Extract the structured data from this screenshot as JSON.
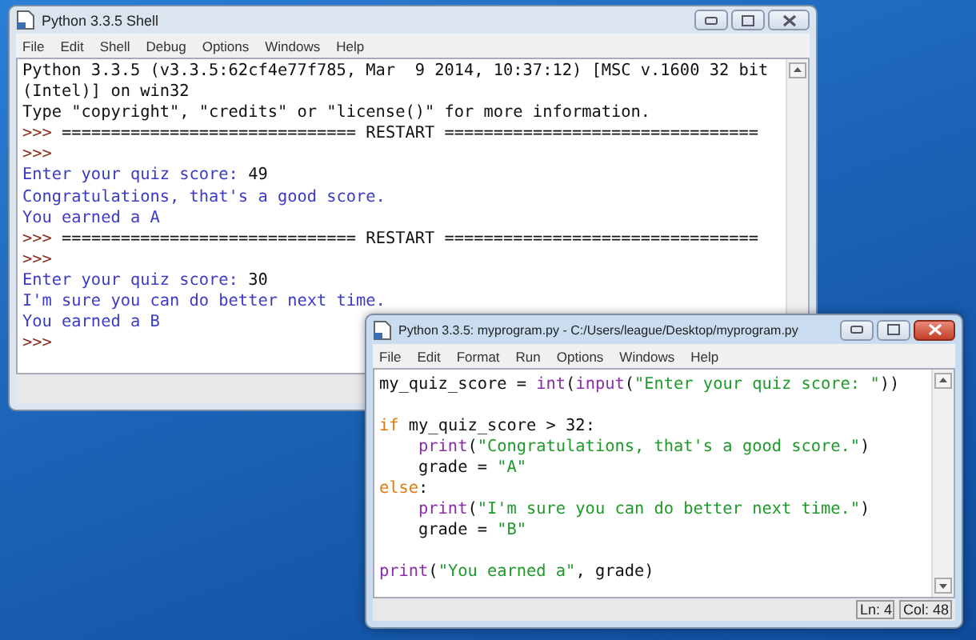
{
  "windows": [
    {
      "kind": "shell",
      "title": "Python 3.3.5 Shell",
      "active": false,
      "menu": [
        "File",
        "Edit",
        "Shell",
        "Debug",
        "Options",
        "Windows",
        "Help"
      ],
      "lines": [
        [
          {
            "text": "Python 3.3.5 (v3.3.5:62cf4e77f785, Mar  9 2014, 10:37:12) [MSC v.1600 32 bit",
            "kind": "plain"
          }
        ],
        [
          {
            "text": "(Intel)] on win32",
            "kind": "plain"
          }
        ],
        [
          {
            "text": "Type \"copyright\", \"credits\" or \"license()\" for more information.",
            "kind": "plain"
          }
        ],
        [
          {
            "text": ">>> ",
            "kind": "prompt"
          },
          {
            "text": "============================== RESTART ================================",
            "kind": "plain"
          }
        ],
        [
          {
            "text": ">>> ",
            "kind": "prompt"
          }
        ],
        [
          {
            "text": "Enter your quiz score: ",
            "kind": "stdout"
          },
          {
            "text": "49",
            "kind": "plain"
          }
        ],
        [
          {
            "text": "Congratulations, that's a good score.",
            "kind": "stdout"
          }
        ],
        [
          {
            "text": "You earned a A",
            "kind": "stdout"
          }
        ],
        [
          {
            "text": ">>> ",
            "kind": "prompt"
          },
          {
            "text": "============================== RESTART ================================",
            "kind": "plain"
          }
        ],
        [
          {
            "text": ">>> ",
            "kind": "prompt"
          }
        ],
        [
          {
            "text": "Enter your quiz score: ",
            "kind": "stdout"
          },
          {
            "text": "30",
            "kind": "plain"
          }
        ],
        [
          {
            "text": "I'm sure you can do better next time.",
            "kind": "stdout"
          }
        ],
        [
          {
            "text": "You earned a B",
            "kind": "stdout"
          }
        ],
        [
          {
            "text": ">>> ",
            "kind": "prompt"
          }
        ]
      ]
    },
    {
      "kind": "editor",
      "title": "Python 3.3.5: myprogram.py - C:/Users/league/Desktop/myprogram.py",
      "active": true,
      "menu": [
        "File",
        "Edit",
        "Format",
        "Run",
        "Options",
        "Windows",
        "Help"
      ],
      "lines": [
        {
          "kind": "code",
          "indent": false,
          "segments": [
            {
              "text": "my_quiz_score = ",
              "kind": "plain"
            },
            {
              "text": "int",
              "kind": "builtin"
            },
            {
              "text": "(",
              "kind": "plain"
            },
            {
              "text": "input",
              "kind": "builtin"
            },
            {
              "text": "(",
              "kind": "plain"
            },
            {
              "text": "\"Enter your quiz score: \"",
              "kind": "string"
            },
            {
              "text": "))",
              "kind": "plain"
            }
          ]
        },
        {
          "kind": "blank"
        },
        {
          "kind": "code",
          "indent": false,
          "segments": [
            {
              "text": "if",
              "kind": "keyword"
            },
            {
              "text": " my_quiz_score > 32:",
              "kind": "plain"
            }
          ]
        },
        {
          "kind": "code",
          "indent": true,
          "segments": [
            {
              "text": "print",
              "kind": "builtin"
            },
            {
              "text": "(",
              "kind": "plain"
            },
            {
              "text": "\"Congratulations, that's a good score.\"",
              "kind": "string"
            },
            {
              "text": ")",
              "kind": "plain"
            }
          ]
        },
        {
          "kind": "code",
          "indent": true,
          "segments": [
            {
              "text": "grade = ",
              "kind": "plain"
            },
            {
              "text": "\"A\"",
              "kind": "string"
            }
          ]
        },
        {
          "kind": "code",
          "indent": false,
          "segments": [
            {
              "text": "else",
              "kind": "keyword"
            },
            {
              "text": ":",
              "kind": "plain"
            }
          ]
        },
        {
          "kind": "code",
          "indent": true,
          "segments": [
            {
              "text": "print",
              "kind": "builtin"
            },
            {
              "text": "(",
              "kind": "plain"
            },
            {
              "text": "\"I'm sure you can do better next time.\"",
              "kind": "string"
            },
            {
              "text": ")",
              "kind": "plain"
            }
          ]
        },
        {
          "kind": "code",
          "indent": true,
          "segments": [
            {
              "text": "grade = ",
              "kind": "plain"
            },
            {
              "text": "\"B\"",
              "kind": "string"
            }
          ]
        },
        {
          "kind": "blank"
        },
        {
          "kind": "code",
          "indent": false,
          "segments": [
            {
              "text": "print",
              "kind": "builtin"
            },
            {
              "text": "(",
              "kind": "plain"
            },
            {
              "text": "\"You earned a\"",
              "kind": "string"
            },
            {
              "text": ", grade)",
              "kind": "plain"
            }
          ]
        }
      ],
      "status": [
        "Ln: 4",
        "Col: 48"
      ]
    }
  ]
}
